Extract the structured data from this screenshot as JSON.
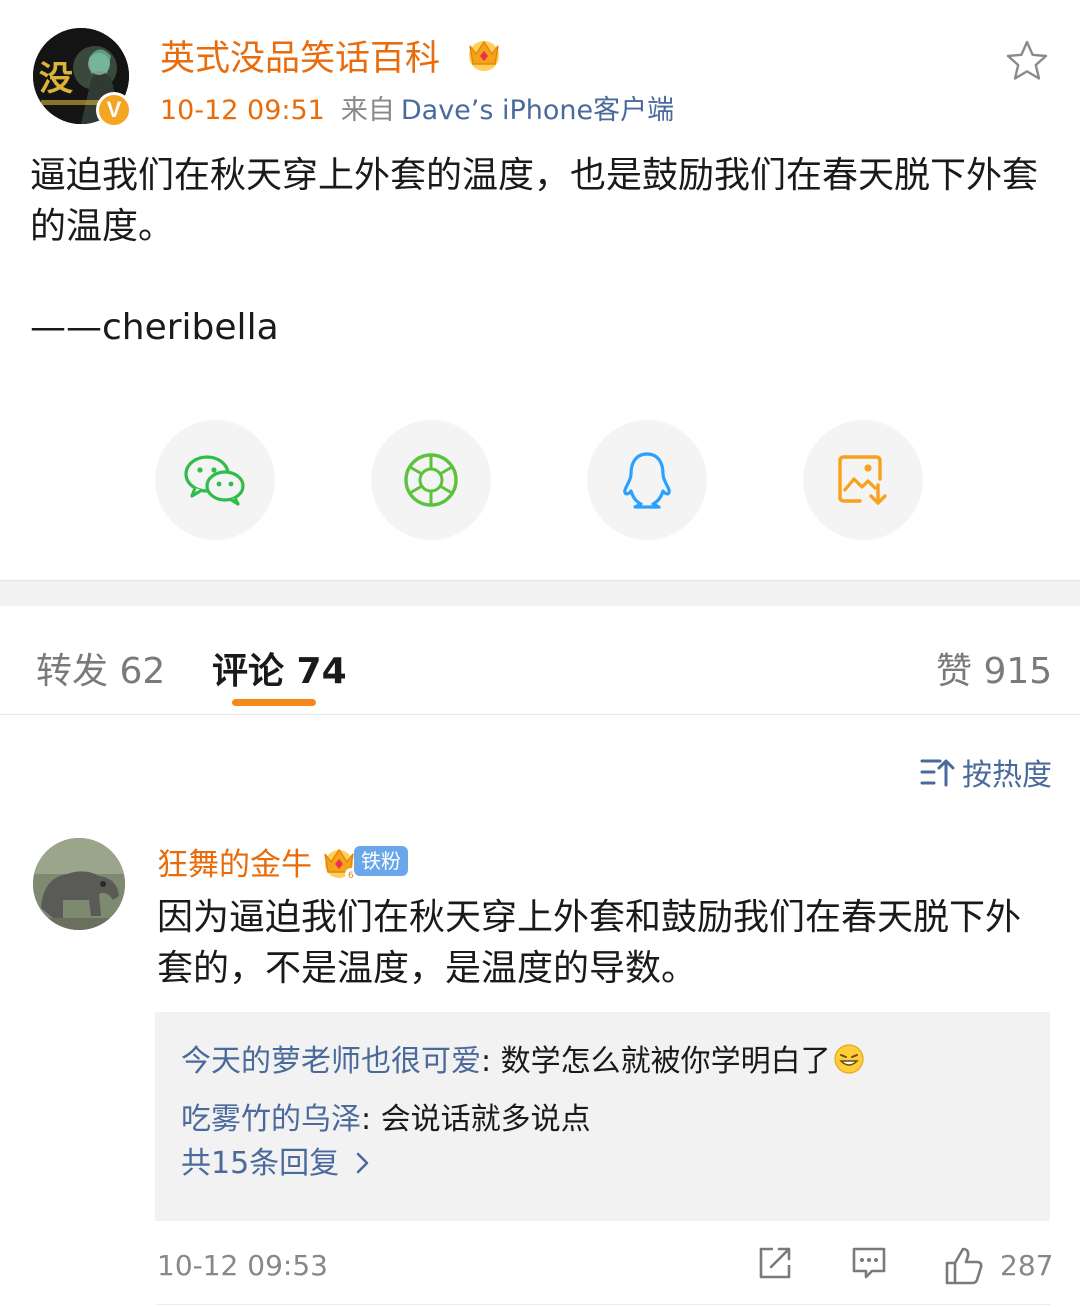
{
  "post": {
    "author": "英式没品笑话百科",
    "time": "10-12 09:51",
    "from_label": "来自",
    "source": "Dave’s iPhone客户端",
    "avatar_text": "没",
    "body": "逼迫我们在秋天穿上外套的温度，也是鼓励我们在春天脱下外套的温度。",
    "signature": "——cheribella"
  },
  "share": [
    {
      "icon": "wechat-icon",
      "color": "#2fbd48"
    },
    {
      "icon": "moments-icon",
      "color": "#5bc23d"
    },
    {
      "icon": "qq-icon",
      "color": "#2aa0ff"
    },
    {
      "icon": "save-image-icon",
      "color": "#f7a21b"
    }
  ],
  "tabs": {
    "repost": "转发 62",
    "comments": "评论 74",
    "likes": "赞 915"
  },
  "sort_label": "按热度",
  "comment": {
    "author": "狂舞的金牛",
    "fan_badge": "铁粉",
    "text": "因为逼迫我们在秋天穿上外套和鼓励我们在春天脱下外套的，不是温度，是温度的导数。",
    "replies": [
      {
        "name": "今天的萝老师也很可爱",
        "text": ": 数学怎么就被你学明白了"
      },
      {
        "name": "吃雾竹的乌泽",
        "text": ": 会说话就多说点"
      }
    ],
    "more_replies": "共15条回复 ",
    "time": "10-12 09:53",
    "like_count": "287"
  },
  "colors": {
    "accent_orange": "#e86b0c",
    "link_blue": "#4a6a9c",
    "tab_underline": "#f58a1a"
  }
}
